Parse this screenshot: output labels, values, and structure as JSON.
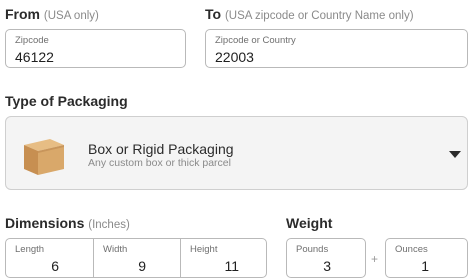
{
  "from": {
    "label": "From",
    "hint": "(USA only)",
    "field_label": "Zipcode",
    "value": "46122"
  },
  "to": {
    "label": "To",
    "hint": "(USA zipcode or Country Name only)",
    "field_label": "Zipcode or Country",
    "value": "22003"
  },
  "packaging": {
    "label": "Type of Packaging",
    "selected_title": "Box or Rigid Packaging",
    "selected_subtitle": "Any custom box or thick parcel",
    "icon": "cardboard-box-icon"
  },
  "dimensions": {
    "label": "Dimensions",
    "hint": "(Inches)",
    "length": {
      "label": "Length",
      "value": "6"
    },
    "width": {
      "label": "Width",
      "value": "9"
    },
    "height": {
      "label": "Height",
      "value": "11"
    }
  },
  "weight": {
    "label": "Weight",
    "pounds": {
      "label": "Pounds",
      "value": "3"
    },
    "plus": "+",
    "ounces": {
      "label": "Ounces",
      "value": "1"
    }
  },
  "colors": {
    "box_light": "#d9a86a",
    "box_dark": "#a9743f",
    "box_top": "#e7bd84"
  }
}
